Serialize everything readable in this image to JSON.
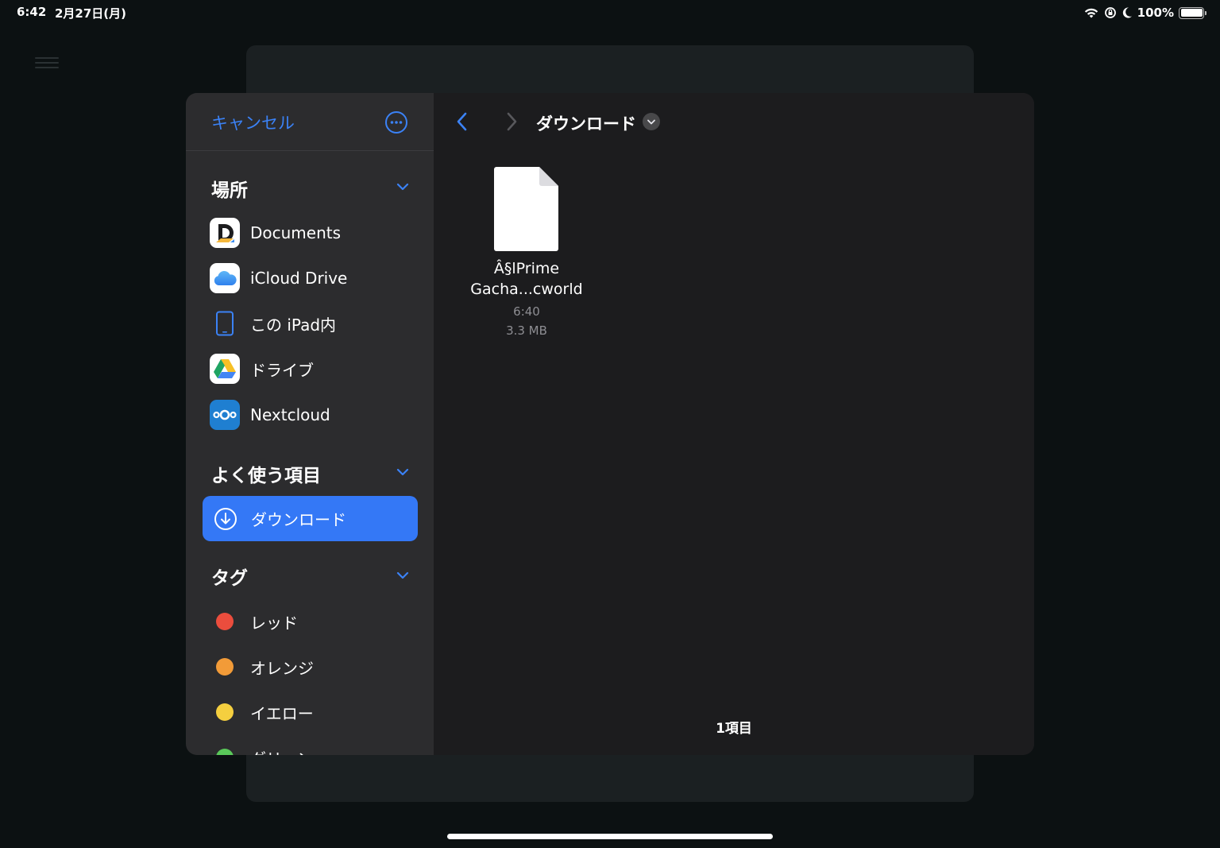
{
  "status_bar": {
    "time": "6:42",
    "date": "2月27日(月)",
    "battery_percent": "100%",
    "battery_level": 1.0,
    "icons": [
      "wifi-icon",
      "orientation-lock-icon",
      "moon-icon",
      "battery-icon"
    ]
  },
  "sidebar": {
    "cancel_label": "キャンセル",
    "more_icon": "ellipsis-circle-icon",
    "sections": {
      "locations": {
        "title": "場所",
        "items": [
          {
            "label": "Documents",
            "icon": "documents-app-icon"
          },
          {
            "label": "iCloud Drive",
            "icon": "icloud-icon"
          },
          {
            "label": "この iPad内",
            "icon": "ipad-icon"
          },
          {
            "label": "ドライブ",
            "icon": "google-drive-icon"
          },
          {
            "label": "Nextcloud",
            "icon": "nextcloud-icon"
          }
        ]
      },
      "favorites": {
        "title": "よく使う項目",
        "items": [
          {
            "label": "ダウンロード",
            "icon": "download-circle-icon",
            "selected": true
          }
        ]
      },
      "tags": {
        "title": "タグ",
        "items": [
          {
            "label": "レッド",
            "color": "#eb4d3d"
          },
          {
            "label": "オレンジ",
            "color": "#f29b38"
          },
          {
            "label": "イエロー",
            "color": "#f5cf3f"
          },
          {
            "label": "グリーン",
            "color": "#5ac85a"
          }
        ]
      }
    }
  },
  "main": {
    "title": "ダウンロード",
    "toolbar_icons": [
      "back-chevron-icon",
      "forward-chevron-icon",
      "new-folder-icon",
      "grid-view-icon",
      "search-icon"
    ],
    "files": [
      {
        "name_line1": "Â§lPrime",
        "name_line2": "Gacha...cworld",
        "time": "6:40",
        "size": "3.3 MB",
        "icon": "document-icon"
      }
    ],
    "item_count": "1項目"
  },
  "colors": {
    "accent": "#3478f6",
    "sidebar_bg": "#2c2c2e",
    "main_bg": "#1c1c1e",
    "backdrop": "#0c1112"
  }
}
